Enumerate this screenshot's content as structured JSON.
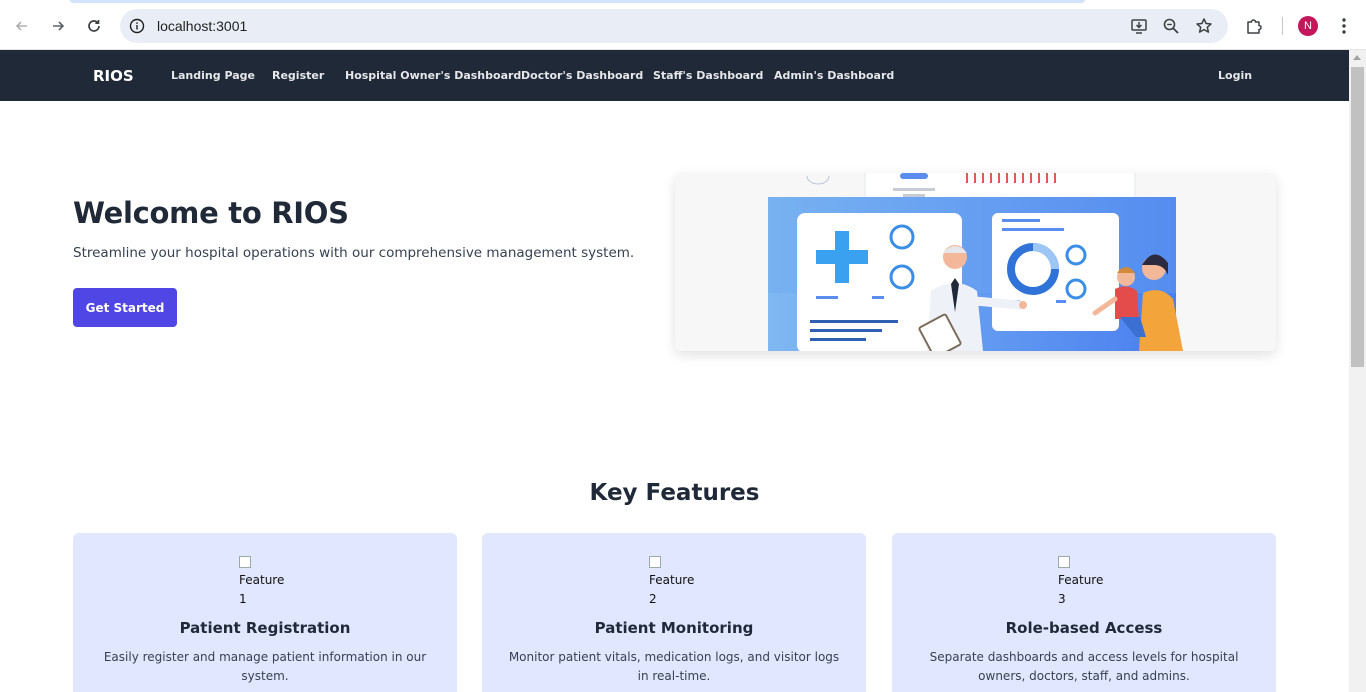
{
  "browser": {
    "url": "localhost:3001",
    "profile_initial": "N",
    "profile_color": "#c2185b"
  },
  "nav": {
    "brand": "RIOS",
    "links": [
      "Landing Page",
      "Register",
      "Hospital Owner's Dashboard",
      "Doctor's Dashboard",
      "Staff's Dashboard",
      "Admin's Dashboard"
    ],
    "login": "Login",
    "background": "#1f2937"
  },
  "hero": {
    "title": "Welcome to RIOS",
    "subtitle": "Streamline your hospital operations with our comprehensive management system.",
    "cta": "Get Started",
    "cta_color": "#4f46e5"
  },
  "features": {
    "title": "Key Features",
    "cards": [
      {
        "img_alt": "Feature 1",
        "img_alt_line1": "Feature",
        "img_alt_line2": "1",
        "title": "Patient Registration",
        "description": "Easily register and manage patient information in our system."
      },
      {
        "img_alt": "Feature 2",
        "img_alt_line1": "Feature",
        "img_alt_line2": "2",
        "title": "Patient Monitoring",
        "description": "Monitor patient vitals, medication logs, and visitor logs in real-time."
      },
      {
        "img_alt": "Feature 3",
        "img_alt_line1": "Feature",
        "img_alt_line2": "3",
        "title": "Role-based Access",
        "description": "Separate dashboards and access levels for hospital owners, doctors, staff, and admins."
      }
    ],
    "card_color": "#e0e7ff"
  }
}
